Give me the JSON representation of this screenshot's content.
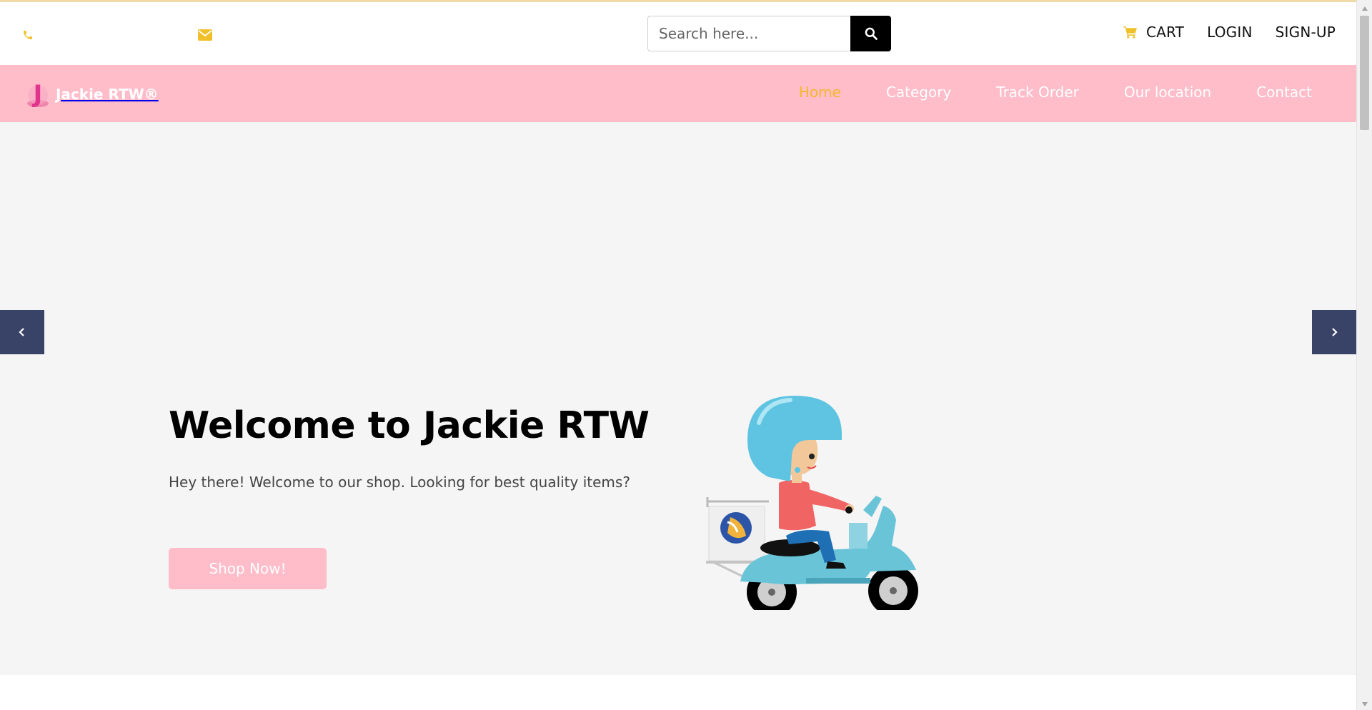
{
  "topbar": {
    "search_placeholder": "Search here...",
    "cart_label": "CART",
    "login_label": "LOGIN",
    "signup_label": "SIGN-UP"
  },
  "icons": {
    "phone": "phone-icon",
    "mail": "mail-icon",
    "search": "search-icon",
    "cart": "cart-icon",
    "prev": "chevron-left-icon",
    "next": "chevron-right-icon"
  },
  "brand": {
    "logo_letter": "J",
    "name": "Jackie RTW®"
  },
  "nav": {
    "items": [
      {
        "label": "Home",
        "active": true
      },
      {
        "label": "Category",
        "active": false
      },
      {
        "label": "Track Order",
        "active": false
      },
      {
        "label": "Our location",
        "active": false
      },
      {
        "label": "Contact",
        "active": false
      }
    ]
  },
  "hero": {
    "title": "Welcome to Jackie RTW",
    "subtitle": "Hey there! Welcome to our shop. Looking for best quality items?",
    "cta_label": "Shop Now!"
  },
  "colors": {
    "nav_background": "#ffbcc9",
    "active_nav": "#f5b829",
    "icon_accent": "#f0c02a",
    "slider_arrow": "#394368",
    "hero_background": "#f5f5f5"
  }
}
